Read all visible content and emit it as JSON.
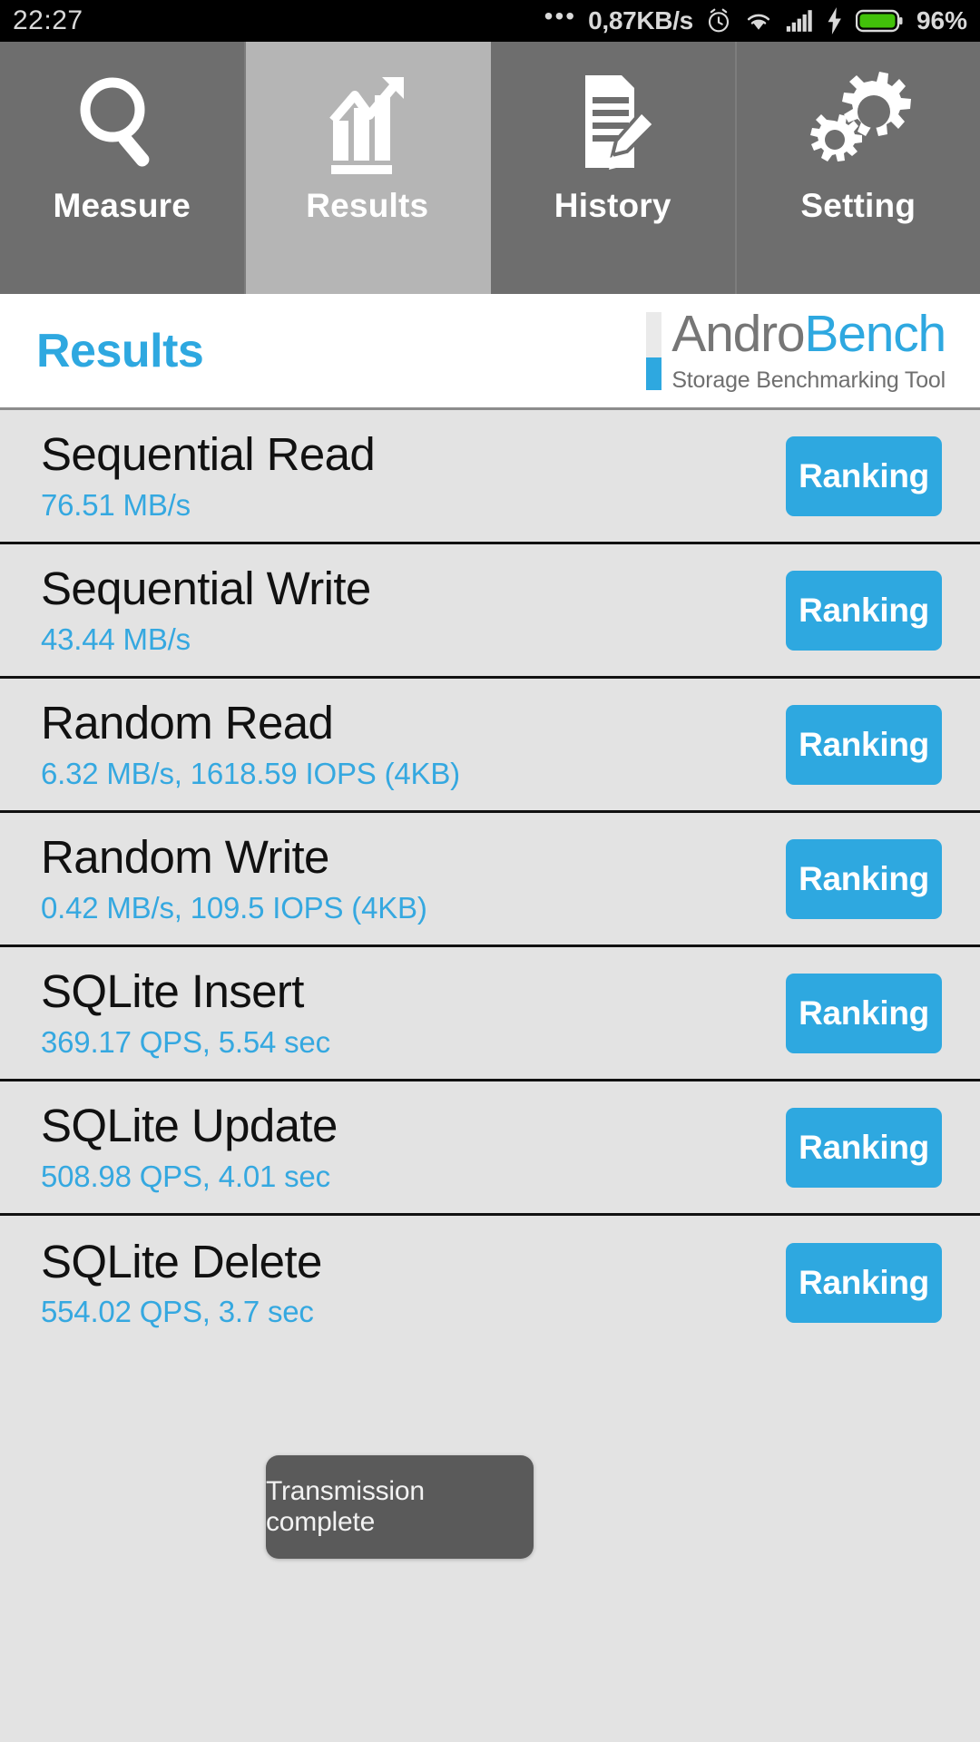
{
  "statusbar": {
    "clock": "22:27",
    "overflow_dots": "•••",
    "net_rate": "0,87KB/s",
    "battery_percent": "96%",
    "icons": [
      "alarm-icon",
      "wifi-icon",
      "signal-icon",
      "charging-bolt-icon",
      "battery-icon"
    ],
    "battery_color": "#42c10a"
  },
  "tabs": [
    {
      "label": "Measure",
      "icon": "magnifier-icon",
      "active": false
    },
    {
      "label": "Results",
      "icon": "bar-chart-arrow-icon",
      "active": true
    },
    {
      "label": "History",
      "icon": "document-pencil-icon",
      "active": false
    },
    {
      "label": "Setting",
      "icon": "gears-icon",
      "active": false
    }
  ],
  "header": {
    "title": "Results",
    "brand_first": "Andro",
    "brand_second": "Bench",
    "brand_sub": "Storage Benchmarking Tool",
    "accent_color": "#2ea8e0",
    "brand_gray": "#767676"
  },
  "results": [
    {
      "title": "Sequential Read",
      "value": "76.51 MB/s",
      "button": "Ranking"
    },
    {
      "title": "Sequential Write",
      "value": "43.44 MB/s",
      "button": "Ranking"
    },
    {
      "title": "Random Read",
      "value": "6.32 MB/s, 1618.59 IOPS (4KB)",
      "button": "Ranking"
    },
    {
      "title": "Random Write",
      "value": "0.42 MB/s, 109.5 IOPS (4KB)",
      "button": "Ranking"
    },
    {
      "title": "SQLite Insert",
      "value": "369.17 QPS, 5.54 sec",
      "button": "Ranking"
    },
    {
      "title": "SQLite Update",
      "value": "508.98 QPS, 4.01 sec",
      "button": "Ranking"
    },
    {
      "title": "SQLite Delete",
      "value": "554.02 QPS, 3.7 sec",
      "button": "Ranking"
    }
  ],
  "toast": {
    "message": "Transmission complete"
  }
}
